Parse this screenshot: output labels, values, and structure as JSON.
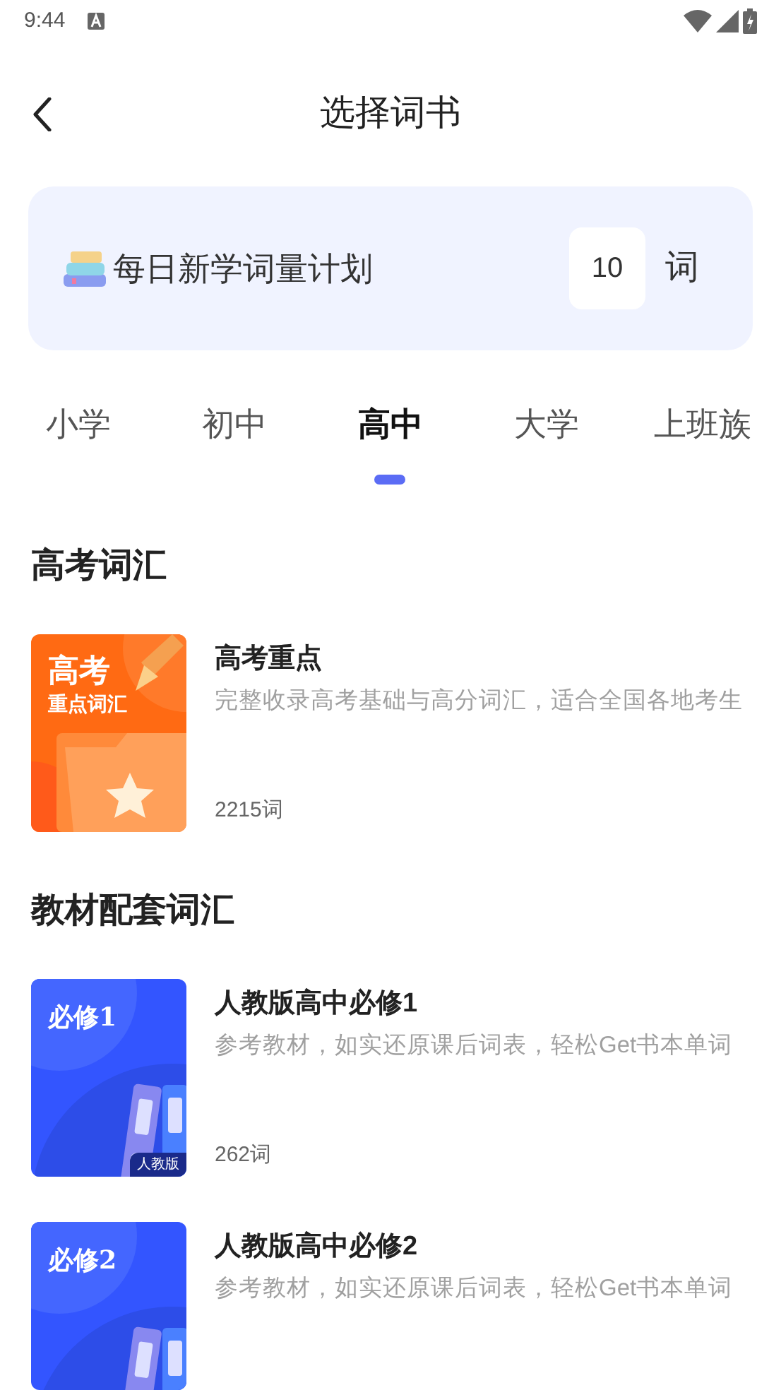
{
  "status_bar": {
    "time": "9:44"
  },
  "header": {
    "title": "选择词书"
  },
  "plan": {
    "label": "每日新学词量计划",
    "value": "10",
    "unit": "词"
  },
  "tabs": [
    {
      "label": "小学",
      "selected": false
    },
    {
      "label": "初中",
      "selected": false
    },
    {
      "label": "高中",
      "selected": true
    },
    {
      "label": "大学",
      "selected": false
    },
    {
      "label": "上班族",
      "selected": false
    }
  ],
  "sections": [
    {
      "title": "高考词汇",
      "books": [
        {
          "kind": "orange",
          "cover_title": "高考",
          "cover_subtitle": "重点词汇",
          "title": "高考重点",
          "description": "完整收录高考基础与高分词汇，适合全国各地考生",
          "count": "2215词"
        }
      ]
    },
    {
      "title": "教材配套词汇",
      "books": [
        {
          "kind": "blue",
          "cover_title": "必修1",
          "cover_badge": "人教版",
          "title": "人教版高中必修1",
          "description": "参考教材，如实还原课后词表，轻松Get书本单词",
          "count": "262词"
        },
        {
          "kind": "blue",
          "cover_title": "必修2",
          "title": "人教版高中必修2",
          "description": "参考教材，如实还原课后词表，轻松Get书本单词"
        }
      ]
    }
  ]
}
